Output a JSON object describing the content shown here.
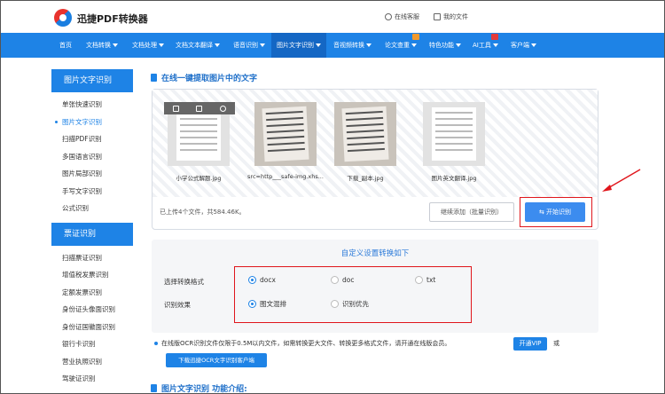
{
  "header": {
    "brand": "迅捷PDF转换器",
    "links": [
      {
        "label": "在线客服",
        "icon": "headset-icon"
      },
      {
        "label": "我的文件",
        "icon": "file-icon"
      }
    ]
  },
  "nav": {
    "items": [
      {
        "label": "首页",
        "dropdown": false
      },
      {
        "label": "文档转换",
        "dropdown": true
      },
      {
        "label": "文档处理",
        "dropdown": true
      },
      {
        "label": "文档文本翻译",
        "dropdown": true
      },
      {
        "label": "语音识别",
        "dropdown": true
      },
      {
        "label": "图片文字识别",
        "dropdown": true,
        "active": true
      },
      {
        "label": "音视频转换",
        "dropdown": true
      },
      {
        "label": "论文查重",
        "dropdown": true,
        "badge": true
      },
      {
        "label": "特色功能",
        "dropdown": true
      },
      {
        "label": "AI工具",
        "dropdown": true,
        "badge": true
      },
      {
        "label": "客户端",
        "dropdown": true
      }
    ]
  },
  "sidebar": {
    "sections": [
      {
        "title": "图片文字识别",
        "items": [
          "单张快速识别",
          "图片文字识别",
          "扫描PDF识别",
          "多国语言识别",
          "图片局部识别",
          "手写文字识别",
          "公式识别"
        ],
        "active_index": 1
      },
      {
        "title": "票证识别",
        "items": [
          "扫描票证识别",
          "增值税发票识别",
          "定额发票识别",
          "身份证头像面识别",
          "身份证国徽面识别",
          "银行卡识别",
          "营业执照识别",
          "驾驶证识别"
        ]
      }
    ]
  },
  "main": {
    "title": "在线一键提取图片中的文字",
    "files": [
      {
        "name": "小学公式解题.jpg",
        "kind": "doc"
      },
      {
        "name": "src=http___safe-img.xhs...",
        "kind": "photo"
      },
      {
        "name": "下载_副本.jpg",
        "kind": "photo"
      },
      {
        "name": "图片英文翻译.jpg",
        "kind": "doc"
      }
    ],
    "upload_info": "已上传4个文件，共584.46K。",
    "continue_button": "继续添加（批量识别）",
    "start_button": "开始识别"
  },
  "settings": {
    "title": "自定义设置转换如下",
    "format_label": "选择转换格式",
    "format_options": [
      "docx",
      "doc",
      "txt"
    ],
    "format_selected": "docx",
    "effect_label": "识别效果",
    "effect_options": [
      "图文混排",
      "识别优先"
    ],
    "effect_selected": "图文混排"
  },
  "notice": {
    "text": "在线版OCR识别文件仅限于0.5M以内文件，如需转换更大文件、转换更多格式文件，请开通在线版会员。",
    "vip_button": "开通VIP",
    "or_text": "或",
    "client_button": "下载迅捷OCR文字识别客户端"
  },
  "intro_title": "图片文字识别 功能介绍:",
  "colors": {
    "primary": "#1e83e6",
    "highlight": "#e0161c"
  }
}
